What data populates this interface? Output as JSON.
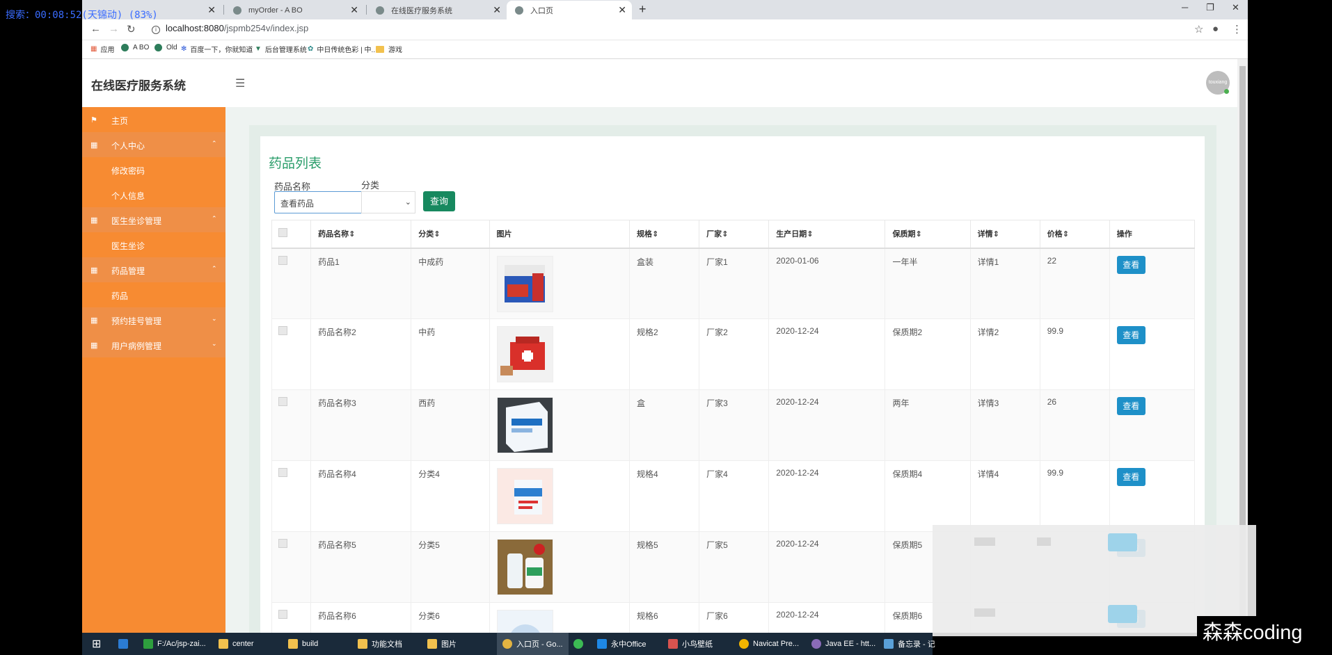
{
  "recorder": {
    "text": "搜索：00:08:52(天锦动) (83%)"
  },
  "tabs": [
    {
      "label": "myOrder - A BO"
    },
    {
      "label": "在线医疗服务系统"
    },
    {
      "label": "入口页"
    }
  ],
  "address": {
    "host": "localhost:8080",
    "path": "/jspmb254v/index.jsp"
  },
  "bookmarks": [
    {
      "label": "应用"
    },
    {
      "label": "A BO"
    },
    {
      "label": "Old"
    },
    {
      "label": "百度一下，你就知道"
    },
    {
      "label": "后台管理系统"
    },
    {
      "label": "中日传统色彩 | 中..."
    },
    {
      "label": "游戏"
    }
  ],
  "header": {
    "brand": "在线医疗服务系统",
    "avatar_text": "touxiang"
  },
  "sidebar": {
    "items": [
      {
        "label": "主页",
        "icon": "flag-icon"
      },
      {
        "label": "个人中心",
        "icon": "grid-icon"
      },
      {
        "label": "修改密码"
      },
      {
        "label": "个人信息"
      },
      {
        "label": "医生坐诊管理",
        "icon": "grid-icon"
      },
      {
        "label": "医生坐诊"
      },
      {
        "label": "药品管理",
        "icon": "grid-icon"
      },
      {
        "label": "药品"
      },
      {
        "label": "预约挂号管理",
        "icon": "grid-icon"
      },
      {
        "label": "用户病例管理",
        "icon": "grid-icon"
      }
    ]
  },
  "main": {
    "title": "药品列表",
    "filters": {
      "name_label": "药品名称",
      "name_value": "查看药品",
      "category_label": "分类",
      "category_value": "",
      "search_button": "查询"
    },
    "columns": [
      "药品名称",
      "分类",
      "图片",
      "规格",
      "厂家",
      "生产日期",
      "保质期",
      "详情",
      "价格",
      "操作"
    ],
    "action_label": "查看",
    "rows": [
      {
        "name": "药品1",
        "category": "中成药",
        "spec": "盒装",
        "maker": "厂家1",
        "date": "2020-01-06",
        "shelf": "一年半",
        "detail": "详情1",
        "price": "22"
      },
      {
        "name": "药品名称2",
        "category": "中药",
        "spec": "规格2",
        "maker": "厂家2",
        "date": "2020-12-24",
        "shelf": "保质期2",
        "detail": "详情2",
        "price": "99.9"
      },
      {
        "name": "药品名称3",
        "category": "西药",
        "spec": "盒",
        "maker": "厂家3",
        "date": "2020-12-24",
        "shelf": "两年",
        "detail": "详情3",
        "price": "26"
      },
      {
        "name": "药品名称4",
        "category": "分类4",
        "spec": "规格4",
        "maker": "厂家4",
        "date": "2020-12-24",
        "shelf": "保质期4",
        "detail": "详情4",
        "price": "99.9"
      },
      {
        "name": "药品名称5",
        "category": "分类5",
        "spec": "规格5",
        "maker": "厂家5",
        "date": "2020-12-24",
        "shelf": "保质期5",
        "detail": "",
        "price": ""
      },
      {
        "name": "药品名称6",
        "category": "分类6",
        "spec": "规格6",
        "maker": "厂家6",
        "date": "2020-12-24",
        "shelf": "保质期6",
        "detail": "",
        "price": ""
      }
    ]
  },
  "taskbar": {
    "items": [
      {
        "label": "F:/Ac/jsp-zai..."
      },
      {
        "label": "center"
      },
      {
        "label": "build"
      },
      {
        "label": "功能文档"
      },
      {
        "label": "图片"
      },
      {
        "label": "入口页 - Go..."
      },
      {
        "label": ""
      },
      {
        "label": "永中Office"
      },
      {
        "label": "小鸟壁纸"
      },
      {
        "label": "Navicat Pre..."
      },
      {
        "label": "Java EE - htt..."
      },
      {
        "label": "备忘录 - 记"
      }
    ]
  },
  "watermark": {
    "text": "森森coding"
  },
  "colors": {
    "sidebar": "#f78b32",
    "accent": "#2a9d6a",
    "query_button": "#17895f",
    "view_button": "#1e90c8"
  }
}
